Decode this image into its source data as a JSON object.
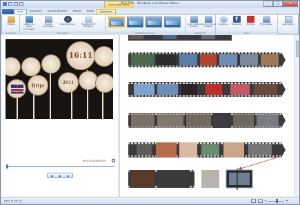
{
  "window": {
    "title": "Mijn film - Windows Live Movie Maker",
    "context_tag": "Outils vidéo video",
    "controls": {
      "minimize": "–",
      "maximize": "□",
      "close": "x"
    }
  },
  "ribbon": {
    "tabs": [
      {
        "label": "Start"
      },
      {
        "label": "Animaties"
      },
      {
        "label": "Visuele effecten"
      },
      {
        "label": "Project"
      },
      {
        "label": "Beeld"
      },
      {
        "label": "Bewerken"
      }
    ],
    "groups": {
      "klembord": {
        "label": "Klembord",
        "buttons": [
          {
            "label": "Plakken"
          }
        ]
      },
      "toevoegen": {
        "label": "Toevoegen",
        "buttons": [
          {
            "label": "Video's en foto's toevoegen"
          },
          {
            "label": "Muziek toevoegen"
          },
          {
            "label": "Webcamvideo"
          },
          {
            "label": "Titel Bijschrift Aftiteling"
          }
        ]
      },
      "automovie": {
        "label": "AutoMovie-thema's"
      },
      "bewerken": {
        "label": "Bewerken",
        "buttons": [
          {
            "label": "Links roteren draaien"
          },
          {
            "label": "Rechts roteren draaien"
          }
        ]
      },
      "delen": {
        "label": "Delen",
        "buttons": [
          {
            "label": "SkyDrive"
          },
          {
            "label": "Facebook"
          },
          {
            "label": "YouTube"
          },
          {
            "label": "Film opslaan"
          }
        ]
      },
      "aanmelden": {
        "label": "",
        "buttons": [
          {
            "label": "Aanmelden"
          }
        ]
      }
    }
  },
  "preview": {
    "timecode": "00:01:31/00:05:20",
    "cookie_texts": [
      "16:11",
      "Bitje",
      "2011"
    ]
  },
  "status": {
    "text": "Item 36 van 36"
  },
  "colors": {
    "accent": "#2b5a9d",
    "ribbon_bg": "#dfe9f5",
    "storyboard_strip": "#3a3a3a",
    "insertion_marker": "#d23b3b"
  }
}
